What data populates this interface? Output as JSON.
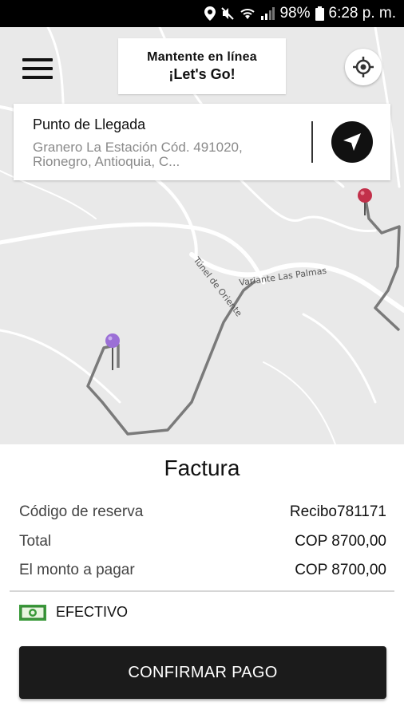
{
  "statusbar": {
    "battery": "98%",
    "time": "6:28 p. m."
  },
  "map": {
    "labels": {
      "road1": "Túnel de Oriente",
      "road2": "Variante Las Palmas"
    }
  },
  "header": {
    "status_line1": "Mantente en línea",
    "status_line2": "¡Let's Go!"
  },
  "destination": {
    "title": "Punto de Llegada",
    "address": "Granero La Estación Cód. 491020, Rionegro, Antioquia, C..."
  },
  "invoice": {
    "title": "Factura",
    "rows": [
      {
        "label": "Código de reserva",
        "value": "Recibo781171"
      },
      {
        "label": "Total",
        "value": "COP 8700,00"
      },
      {
        "label": "El monto a pagar",
        "value": "COP 8700,00"
      }
    ],
    "payment_method": "EFECTIVO",
    "confirm_label": "CONFIRMAR PAGO"
  },
  "icons": {
    "menu": "hamburger-menu-icon",
    "locate": "crosshair-locate-icon",
    "navigate": "navigation-arrow-icon",
    "cash": "cash-bill-icon",
    "pin_origin": "purple-pin-icon",
    "pin_destination": "red-pin-icon"
  },
  "colors": {
    "route": "#7a7a7a",
    "origin_pin": "#9b6fd6",
    "destination_pin": "#c2304a",
    "button_bg": "#1b1b1b"
  }
}
